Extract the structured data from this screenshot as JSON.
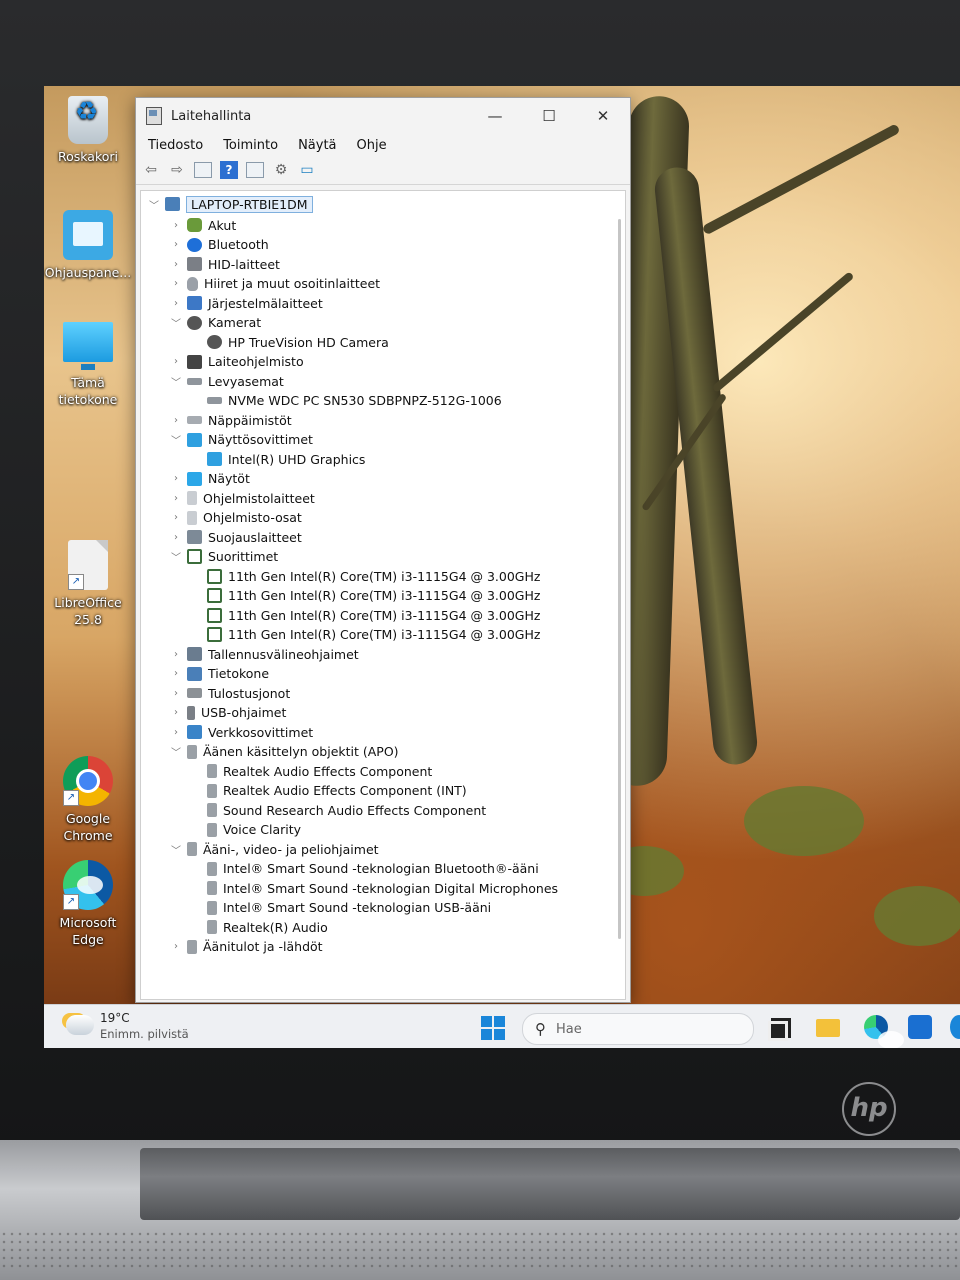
{
  "desktop": {
    "icons": [
      {
        "label": "Roskakori"
      },
      {
        "label": "Ohjauspane..."
      },
      {
        "label": "Tämä tietokone"
      },
      {
        "label": "LibreOffice 25.8"
      },
      {
        "label": "Google Chrome"
      },
      {
        "label": "Microsoft Edge"
      }
    ]
  },
  "window": {
    "title": "Laitehallinta",
    "controls": {
      "minimize": "—",
      "maximize": "☐",
      "close": "✕"
    },
    "menu": [
      "Tiedosto",
      "Toiminto",
      "Näytä",
      "Ohje"
    ],
    "toolbar_icons": [
      "back-arrow-icon",
      "forward-arrow-icon",
      "properties-icon",
      "help-icon",
      "view-icon",
      "scan-icon",
      "monitor-icon"
    ]
  },
  "tree": {
    "root": "LAPTOP-RTBIE1DM",
    "nodes": [
      {
        "label": "Akut",
        "level": 1,
        "state": "collapsed",
        "icon": "battery-icon"
      },
      {
        "label": "Bluetooth",
        "level": 1,
        "state": "collapsed",
        "icon": "bluetooth-icon"
      },
      {
        "label": "HID-laitteet",
        "level": 1,
        "state": "collapsed",
        "icon": "hid-icon"
      },
      {
        "label": "Hiiret ja muut osoitinlaitteet",
        "level": 1,
        "state": "collapsed",
        "icon": "mouse-icon"
      },
      {
        "label": "Järjestelmälaitteet",
        "level": 1,
        "state": "collapsed",
        "icon": "system-device-icon"
      },
      {
        "label": "Kamerat",
        "level": 1,
        "state": "expanded",
        "icon": "camera-icon"
      },
      {
        "label": "HP TrueVision HD Camera",
        "level": 2,
        "state": "leaf",
        "icon": "camera-icon"
      },
      {
        "label": "Laiteohjelmisto",
        "level": 1,
        "state": "collapsed",
        "icon": "firmware-icon"
      },
      {
        "label": "Levyasemat",
        "level": 1,
        "state": "expanded",
        "icon": "disk-icon"
      },
      {
        "label": "NVMe WDC PC SN530 SDBPNPZ-512G-1006",
        "level": 2,
        "state": "leaf",
        "icon": "disk-icon"
      },
      {
        "label": "Näppäimistöt",
        "level": 1,
        "state": "collapsed",
        "icon": "keyboard-icon"
      },
      {
        "label": "Näyttösovittimet",
        "level": 1,
        "state": "expanded",
        "icon": "display-adapter-icon"
      },
      {
        "label": "Intel(R) UHD Graphics",
        "level": 2,
        "state": "leaf",
        "icon": "display-adapter-icon"
      },
      {
        "label": "Näytöt",
        "level": 1,
        "state": "collapsed",
        "icon": "monitor-icon"
      },
      {
        "label": "Ohjelmistolaitteet",
        "level": 1,
        "state": "collapsed",
        "icon": "software-device-icon"
      },
      {
        "label": "Ohjelmisto-osat",
        "level": 1,
        "state": "collapsed",
        "icon": "software-component-icon"
      },
      {
        "label": "Suojauslaitteet",
        "level": 1,
        "state": "collapsed",
        "icon": "security-device-icon"
      },
      {
        "label": "Suorittimet",
        "level": 1,
        "state": "expanded",
        "icon": "processor-icon"
      },
      {
        "label": "11th Gen Intel(R) Core(TM) i3-1115G4 @ 3.00GHz",
        "level": 2,
        "state": "leaf",
        "icon": "processor-icon"
      },
      {
        "label": "11th Gen Intel(R) Core(TM) i3-1115G4 @ 3.00GHz",
        "level": 2,
        "state": "leaf",
        "icon": "processor-icon"
      },
      {
        "label": "11th Gen Intel(R) Core(TM) i3-1115G4 @ 3.00GHz",
        "level": 2,
        "state": "leaf",
        "icon": "processor-icon"
      },
      {
        "label": "11th Gen Intel(R) Core(TM) i3-1115G4 @ 3.00GHz",
        "level": 2,
        "state": "leaf",
        "icon": "processor-icon"
      },
      {
        "label": "Tallennusvälineohjaimet",
        "level": 1,
        "state": "collapsed",
        "icon": "storage-controller-icon"
      },
      {
        "label": "Tietokone",
        "level": 1,
        "state": "collapsed",
        "icon": "computer-icon"
      },
      {
        "label": "Tulostusjonot",
        "level": 1,
        "state": "collapsed",
        "icon": "printer-icon"
      },
      {
        "label": "USB-ohjaimet",
        "level": 1,
        "state": "collapsed",
        "icon": "usb-icon"
      },
      {
        "label": "Verkkosovittimet",
        "level": 1,
        "state": "collapsed",
        "icon": "network-adapter-icon"
      },
      {
        "label": "Äänen käsittelyn objektit (APO)",
        "level": 1,
        "state": "expanded",
        "icon": "audio-icon"
      },
      {
        "label": "Realtek Audio Effects Component",
        "level": 2,
        "state": "leaf",
        "icon": "audio-icon"
      },
      {
        "label": "Realtek Audio Effects Component (INT)",
        "level": 2,
        "state": "leaf",
        "icon": "audio-icon"
      },
      {
        "label": "Sound Research Audio Effects Component",
        "level": 2,
        "state": "leaf",
        "icon": "audio-icon"
      },
      {
        "label": "Voice Clarity",
        "level": 2,
        "state": "leaf",
        "icon": "audio-icon"
      },
      {
        "label": "Ääni-, video- ja peliohjaimet",
        "level": 1,
        "state": "expanded",
        "icon": "audio-icon"
      },
      {
        "label": "Intel® Smart Sound -teknologian Bluetooth®-ääni",
        "level": 2,
        "state": "leaf",
        "icon": "audio-icon"
      },
      {
        "label": "Intel® Smart Sound -teknologian Digital Microphones",
        "level": 2,
        "state": "leaf",
        "icon": "audio-icon"
      },
      {
        "label": "Intel® Smart Sound -teknologian USB-ääni",
        "level": 2,
        "state": "leaf",
        "icon": "audio-icon"
      },
      {
        "label": "Realtek(R) Audio",
        "level": 2,
        "state": "leaf",
        "icon": "audio-icon"
      },
      {
        "label": "Äänitulot ja -lähdöt",
        "level": 1,
        "state": "collapsed",
        "icon": "audio-io-icon"
      }
    ]
  },
  "taskbar": {
    "weather": {
      "temp": "19°C",
      "condition": "Enimm. pilvistä"
    },
    "search_placeholder": "Hae",
    "pinned": [
      "task-view-icon",
      "file-explorer-icon",
      "edge-icon",
      "store-icon"
    ]
  },
  "hardware": {
    "brand": "hp"
  }
}
